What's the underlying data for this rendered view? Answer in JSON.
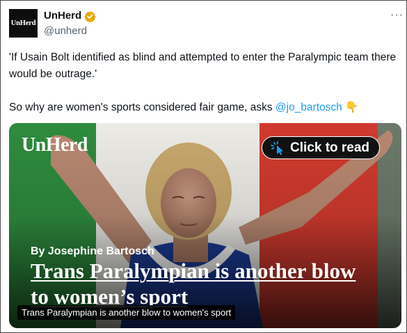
{
  "tweet": {
    "account_name": "UnHerd",
    "handle": "@unherd",
    "avatar_text": "UnHerd",
    "verified_icon": "gold-verified-badge-icon",
    "more_icon": "···",
    "text_line1": "'If Usain Bolt identified as blind and attempted to enter the Paralympic team there would be outrage.'",
    "text_line2_prefix": "So why are women's sports considered fair game, asks ",
    "mention": "@jo_bartosch",
    "emoji": "👇"
  },
  "card": {
    "brand": "UnHerd",
    "cta_label": "Click to read",
    "cta_icon": "cursor-click-icon",
    "byline": "By Josephine Bartosch",
    "headline": "Trans Paralympian is another blow to women’s sport",
    "caption": "Trans Paralympian is another blow to women's sport"
  },
  "colors": {
    "mention": "#1d9bf0",
    "verified": "#e8a80c",
    "flag_green": "#2e8b3e",
    "flag_red": "#d13a2e",
    "jersey_blue": "#1d3c96"
  }
}
